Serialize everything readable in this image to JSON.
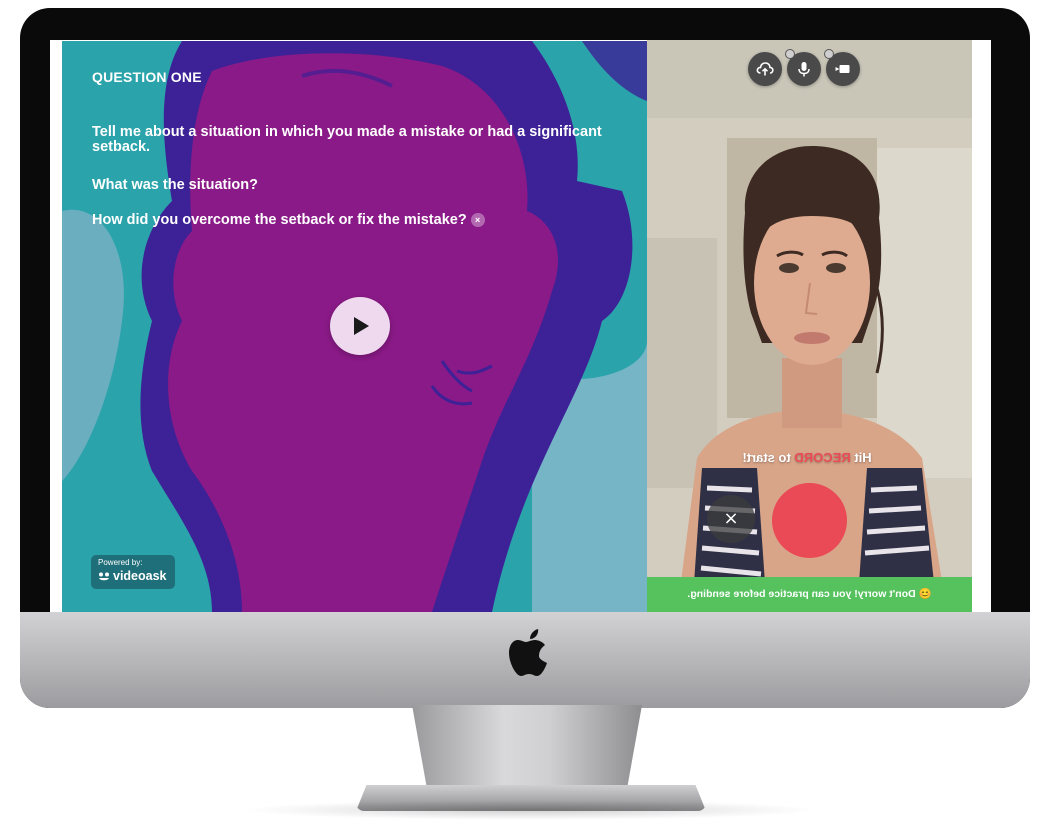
{
  "question": {
    "title": "QUESTION ONE",
    "line1": "Tell me about a situation in which you made a mistake or had a significant setback.",
    "line2": "What was the situation?",
    "line3": "How did you overcome the setback or fix the mistake?",
    "close_glyph": "×"
  },
  "branding": {
    "powered_by": "Powered by:",
    "name": "videoask"
  },
  "camera": {
    "tools": [
      "upload-icon",
      "microphone-icon",
      "camera-icon"
    ],
    "hint_prefix": "Hit ",
    "hint_record": "RECORD",
    "hint_suffix": " to start!",
    "cancel_glyph": "×",
    "practice_text": "😊 Don't worry! you can practice before sending."
  },
  "colors": {
    "teal": "#2aa3ab",
    "magenta": "#8a1a87",
    "record": "#e94a55",
    "banner": "#55c25e"
  }
}
